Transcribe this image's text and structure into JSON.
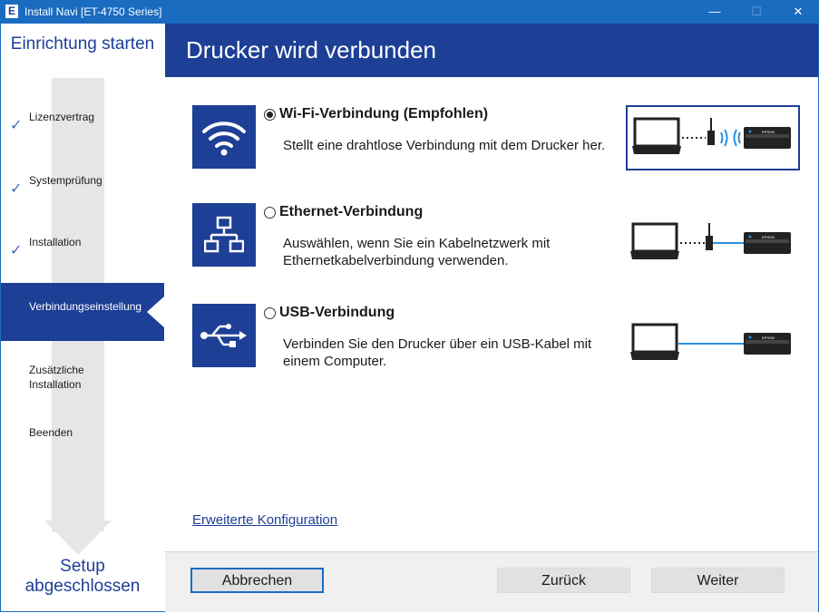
{
  "window": {
    "app_icon_letter": "E",
    "title": "Install Navi [ET-4750 Series]",
    "minimize": "—",
    "maximize": "☐",
    "close": "✕"
  },
  "sidebar": {
    "header": "Einrichtung starten",
    "steps": [
      {
        "label": "Lizenzvertrag",
        "done": true
      },
      {
        "label": "Systemprüfung",
        "done": true
      },
      {
        "label": "Installation",
        "done": true
      },
      {
        "label": "Verbindungseinstellung",
        "active": true
      },
      {
        "label": "Zusätzliche Installation"
      },
      {
        "label": "Beenden"
      }
    ],
    "step_labels": {
      "s1": "Lizenzvertrag",
      "s2": "Systemprüfung",
      "s3": "Installation",
      "s4": "Verbindungseinstellung",
      "s5a": "Zusätzliche",
      "s5b": "Installation",
      "s6": "Beenden"
    },
    "check_glyph": "✓",
    "footer_line1": "Setup",
    "footer_line2": "abgeschlossen"
  },
  "main": {
    "heading": "Drucker wird verbunden",
    "options": {
      "wifi": {
        "title": "Wi-Fi-Verbindung (Empfohlen)",
        "desc": "Stellt eine drahtlose Verbindung mit dem Drucker her.",
        "selected": true,
        "icon": "wifi-icon"
      },
      "ethernet": {
        "title": "Ethernet-Verbindung",
        "desc": "Auswählen, wenn Sie ein Kabelnetzwerk mit Ethernetkabelverbindung verwenden.",
        "selected": false,
        "icon": "network-icon"
      },
      "usb": {
        "title": "USB-Verbindung",
        "desc": "Verbinden Sie den Drucker über ein USB-Kabel mit einem Computer.",
        "selected": false,
        "icon": "usb-icon"
      }
    },
    "printer_brand": "EPSON",
    "advanced_link": "Erweiterte Konfiguration"
  },
  "buttons": {
    "cancel": "Abbrechen",
    "back": "Zurück",
    "next": "Weiter"
  },
  "colors": {
    "brand_blue": "#1d3f95",
    "titlebar_blue": "#1a6cc1",
    "usb_line": "#2a8fe0"
  }
}
